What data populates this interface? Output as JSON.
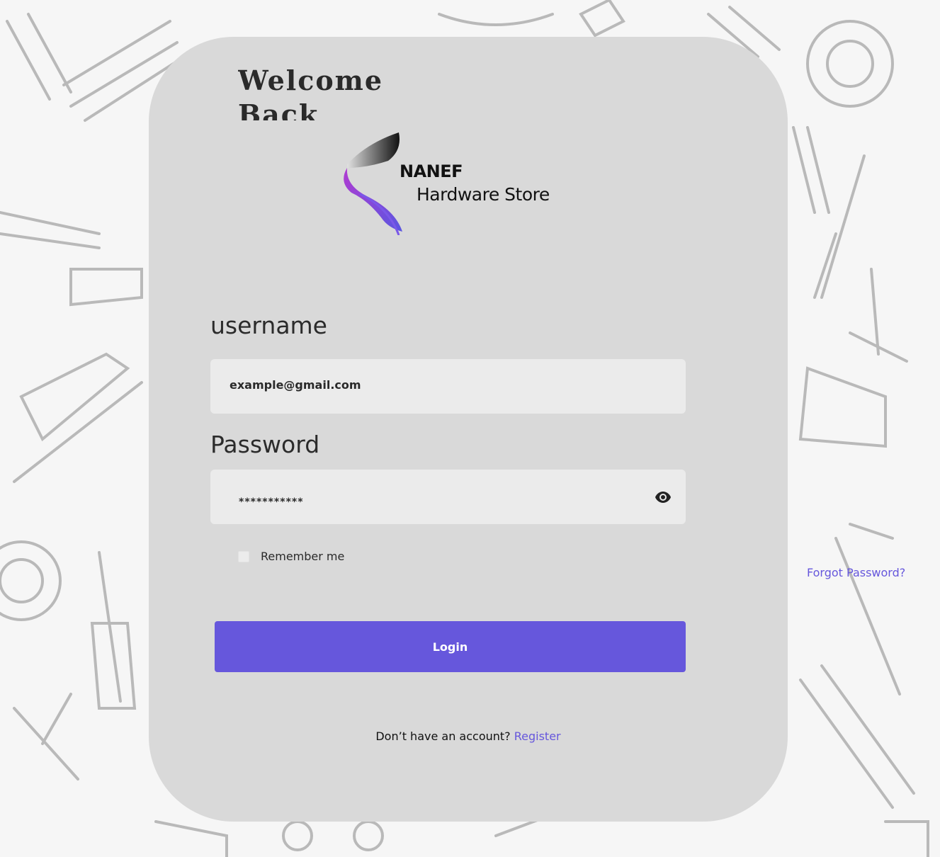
{
  "page": {
    "welcome": "Welcome Back"
  },
  "logo": {
    "brand": "NANEF",
    "subtitle": "Hardware Store"
  },
  "form": {
    "username_label": "username",
    "username_value": "example@gmail.com",
    "password_label": "Password",
    "password_value": "***********",
    "remember_label": "Remember me",
    "forgot_label": "Forgot Password?",
    "login_label": "Login",
    "no_account_text": "Don’t have an account? ",
    "register_label": "Register"
  },
  "colors": {
    "accent": "#6657dc",
    "card": "#d9d9d9",
    "field": "#ebebeb"
  }
}
